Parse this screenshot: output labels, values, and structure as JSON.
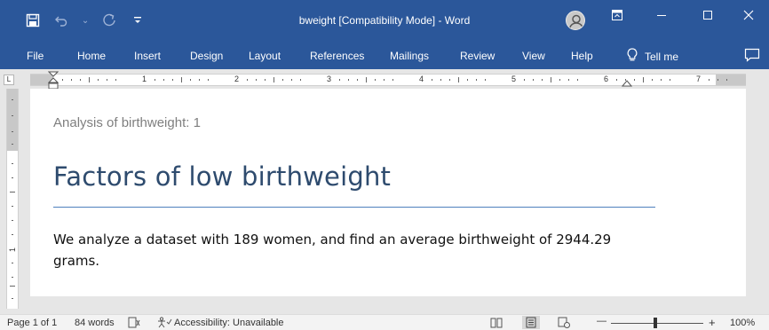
{
  "titlebar": {
    "title": "bweight [Compatibility Mode]  -  Word",
    "colors": {
      "accent": "#2b579a"
    },
    "qat": [
      {
        "icon": "save-icon",
        "glyph": "🖫"
      },
      {
        "icon": "undo-icon",
        "glyph": "↶"
      },
      {
        "icon": "dropdown-icon",
        "glyph": "⌄"
      },
      {
        "icon": "redo-icon",
        "glyph": "↻"
      },
      {
        "icon": "customize-qat-icon",
        "glyph": "⩧"
      }
    ],
    "window_controls": {
      "ribbon_display_glyph": "⊡",
      "minimize_glyph": "—",
      "maximize_glyph": "☐",
      "close_glyph": "✕"
    }
  },
  "ribbon": {
    "tabs": [
      "File",
      "Home",
      "Insert",
      "Design",
      "Layout",
      "References",
      "Mailings",
      "Review",
      "View",
      "Help"
    ],
    "tell_me": "Tell me",
    "tell_me_icon": "lightbulb-icon"
  },
  "ruler": {
    "numbers": [
      "1",
      "2",
      "3",
      "4",
      "5",
      "6",
      "7"
    ]
  },
  "document": {
    "subtitle": "Analysis of birthweight: 1",
    "heading": "Factors of low birthweight",
    "body": " We analyze a dataset with 189 women, and find an average birthweight of 2944.29 grams."
  },
  "statusbar": {
    "page": "Page 1 of 1",
    "words": "84 words",
    "accessibility": "Accessibility: Unavailable",
    "zoom_minus": "—",
    "zoom_plus": "+",
    "zoom": "100%"
  }
}
